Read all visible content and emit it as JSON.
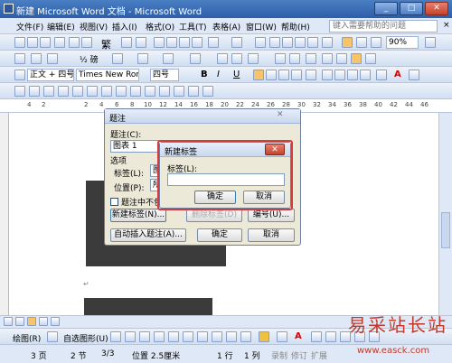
{
  "window": {
    "title": "新建 Microsoft Word 文档 - Microsoft Word",
    "min": "_",
    "max": "□",
    "close": "✕"
  },
  "menu": {
    "items": [
      "文件(F)",
      "编辑(E)",
      "视图(V)",
      "插入(I)",
      "格式(O)",
      "工具(T)",
      "表格(A)",
      "窗口(W)",
      "帮助(H)"
    ],
    "help_placeholder": "键入需要帮助的问题",
    "close": "×"
  },
  "toolbar1": {
    "font_big": "繁",
    "zoom": "90%"
  },
  "toolbar2": {
    "half_label": "½ 磅"
  },
  "toolbar3": {
    "style": "正文 + 四号",
    "font": "Times New Roman",
    "size": "四号",
    "bold": "B",
    "italic": "I",
    "underline": "U",
    "fontcolor": "A"
  },
  "ruler": {
    "numbers": [
      "4",
      "2",
      "2",
      "4",
      "6",
      "8",
      "10",
      "12",
      "14",
      "16",
      "18",
      "20",
      "22",
      "24",
      "26",
      "28",
      "30",
      "32",
      "34",
      "36",
      "38",
      "40",
      "42",
      "44",
      "46"
    ]
  },
  "caption_dialog": {
    "title": "题注",
    "close": "✕",
    "caption_label": "题注(C):",
    "caption_value": "图表 1",
    "options_label": "选项",
    "label_label": "标签(L):",
    "label_value": "图",
    "position_label": "位置(P):",
    "position_value": "所",
    "exclude_label": "题注中不包含",
    "new_label_btn": "新建标签(N)...",
    "delete_label_btn": "删除标签(D)",
    "numbering_btn": "编号(U)...",
    "autocaption_btn": "自动插入题注(A)...",
    "ok_btn": "确定",
    "cancel_btn": "取消"
  },
  "new_label_dialog": {
    "title": "新建标签",
    "close": "✕",
    "label_label": "标签(L):",
    "label_value": "",
    "ok_btn": "确定",
    "cancel_btn": "取消"
  },
  "drawbar": {
    "draw_label": "绘图(R)",
    "autoshape_label": "自选图形(U)"
  },
  "status": {
    "page": "3 页",
    "section": "2 节",
    "pages": "3/3",
    "position": "位置 2.5厘米",
    "line": "1 行",
    "col": "1 列",
    "rec": "录制",
    "trk": "修订",
    "ext": "扩展"
  },
  "watermark": {
    "text": "易采站长站",
    "url": "www.easck.com"
  }
}
